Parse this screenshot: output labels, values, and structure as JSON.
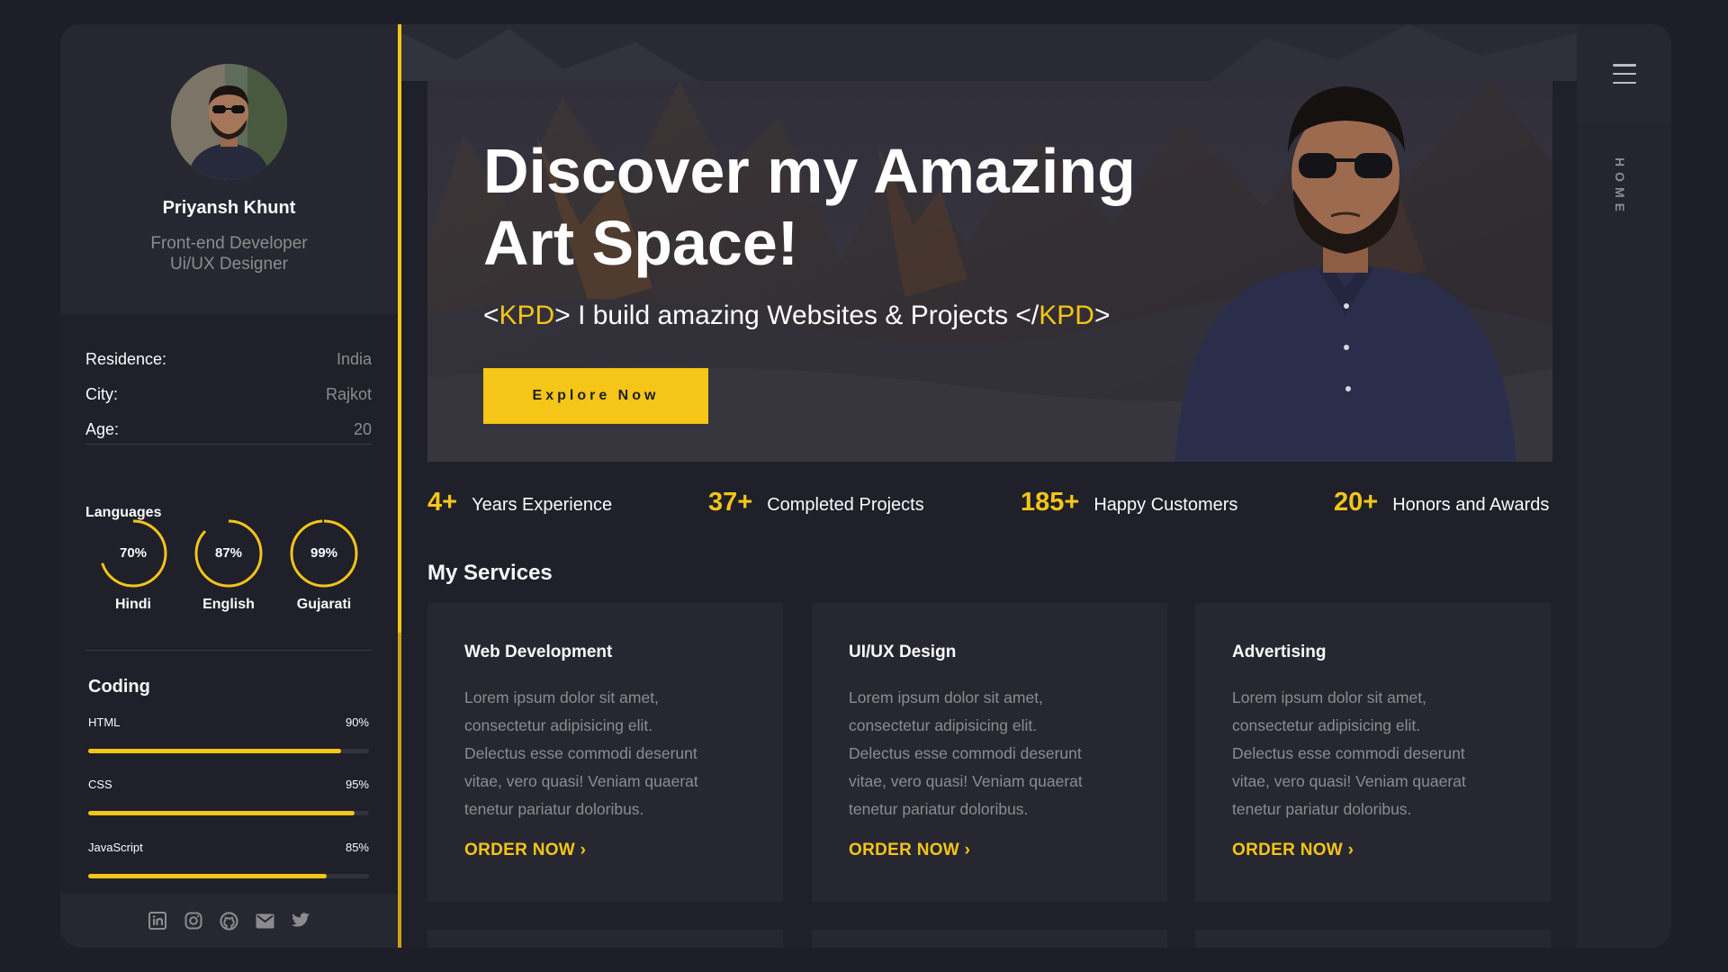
{
  "profile": {
    "name": "Priyansh Khunt",
    "role_line1": "Front-end Developer",
    "role_line2": "Ui/UX Designer"
  },
  "info": [
    {
      "key": "Residence:",
      "value": "India"
    },
    {
      "key": "City:",
      "value": "Rajkot"
    },
    {
      "key": "Age:",
      "value": "20"
    }
  ],
  "languages": {
    "title": "Languages",
    "items": [
      {
        "name": "Hindi",
        "percent_label": "70%",
        "percent": 70
      },
      {
        "name": "English",
        "percent_label": "87%",
        "percent": 87
      },
      {
        "name": "Gujarati",
        "percent_label": "99%",
        "percent": 99
      }
    ]
  },
  "coding": {
    "title": "Coding",
    "items": [
      {
        "name": "HTML",
        "percent_label": "90%",
        "percent": 90
      },
      {
        "name": "CSS",
        "percent_label": "95%",
        "percent": 95
      },
      {
        "name": "JavaScript",
        "percent_label": "85%",
        "percent": 85
      }
    ]
  },
  "social": [
    "linkedin-icon",
    "instagram-icon",
    "github-icon",
    "mail-icon",
    "twitter-icon"
  ],
  "hero": {
    "title_line1": "Discover my Amazing",
    "title_line2": "Art Space!",
    "tag_open_bracket": "<",
    "tag_open_name": "KPD",
    "tag_middle": "> I build amazing Websites & Projects </",
    "tag_close_name": "KPD",
    "tag_close_bracket": ">",
    "button_label": "Explore Now"
  },
  "stats": [
    {
      "number": "4+",
      "label": "Years Experience"
    },
    {
      "number": "37+",
      "label": "Completed Projects"
    },
    {
      "number": "185+",
      "label": "Happy Customers"
    },
    {
      "number": "20+",
      "label": "Honors and Awards"
    }
  ],
  "services": {
    "title": "My Services",
    "cards": [
      {
        "title": "Web Development",
        "text_lines": [
          "Lorem ipsum dolor sit amet,",
          "consectetur adipisicing elit.",
          "Delectus esse commodi deserunt",
          "vitae, vero quasi! Veniam quaerat",
          "tenetur pariatur doloribus."
        ],
        "link": "ORDER NOW"
      },
      {
        "title": "UI/UX Design",
        "text_lines": [
          "Lorem ipsum dolor sit amet,",
          "consectetur adipisicing elit.",
          "Delectus esse commodi deserunt",
          "vitae, vero quasi! Veniam quaerat",
          "tenetur pariatur doloribus."
        ],
        "link": "ORDER NOW"
      },
      {
        "title": "Advertising",
        "text_lines": [
          "Lorem ipsum dolor sit amet,",
          "consectetur adipisicing elit.",
          "Delectus esse commodi deserunt",
          "vitae, vero quasi! Veniam quaerat",
          "tenetur pariatur doloribus."
        ],
        "link": "ORDER NOW"
      }
    ]
  },
  "rail": {
    "label": "HOME",
    "menu_icon": "hamburger-menu-icon"
  },
  "colors": {
    "accent": "#f5c518",
    "background": "#1e1e28",
    "panel": "#272731",
    "muted_text": "#8c8c8e"
  }
}
